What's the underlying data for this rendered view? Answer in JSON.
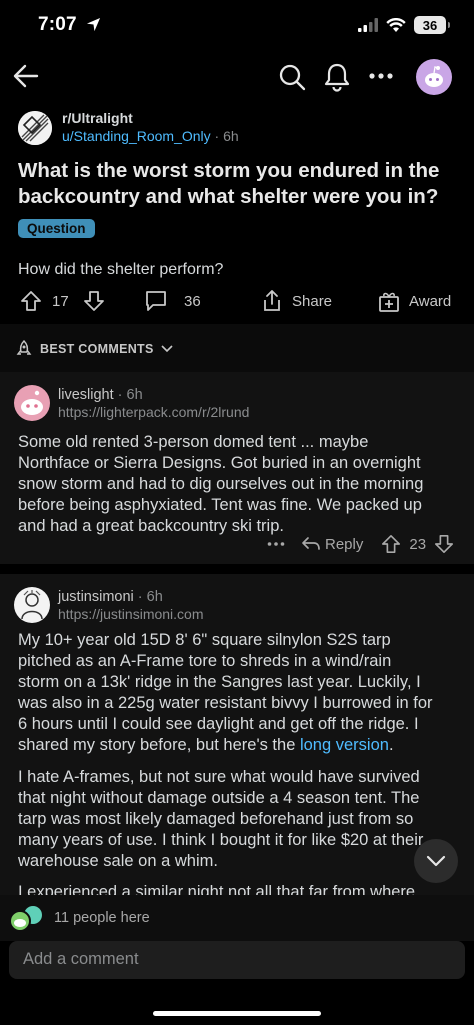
{
  "status_bar": {
    "time": "7:07",
    "battery": "36"
  },
  "header": {
    "back_icon": "arrow-left-icon",
    "search_icon": "search-icon",
    "bell_icon": "bell-icon",
    "more_icon": "more-horizontal-icon"
  },
  "post": {
    "subreddit": "r/Ultralight",
    "author": "u/Standing_Room_Only",
    "age": "6h",
    "title": "What is the worst storm you endured in the backcountry and what shelter were you in?",
    "flair": "Question",
    "body": "How did the shelter perform?",
    "votes": "17",
    "comments": "36",
    "share_label": "Share",
    "award_label": "Award"
  },
  "sort": {
    "label": "BEST COMMENTS"
  },
  "comments": [
    {
      "author": "liveslight",
      "age": "6h",
      "flair": "https://lighterpack.com/r/2lrund",
      "lines": [
        "Some old rented 3-person domed tent ... maybe",
        "Northface or Sierra Designs.  Got buried in an overnight",
        "snow storm and had to dig ourselves out in the morning",
        "before being asphyxiated.  Tent was fine.  We packed up",
        "and had a great backcountry ski trip."
      ],
      "reply_label": "Reply",
      "votes": "23"
    },
    {
      "author": "justinsimoni",
      "age": "6h",
      "flair": "https://justinsimoni.com",
      "p1_lines": [
        "My 10+ year old 15D 8' 6\" square silnylon S2S tarp",
        "pitched as an A-Frame  tore to shreds in a wind/rain",
        "storm on a 13k' ridge in the Sangres last year. Luckily, I",
        "was also in a  225g water resistant bivvy I burrowed in for",
        "6 hours until I could see daylight and get off the ridge. I"
      ],
      "p1_last_prefix": "shared my story before, but here's the ",
      "p1_link": "long version",
      "p1_last_suffix": ".",
      "p2_lines": [
        "I hate A-frames, but not sure what would have survived",
        "that night without damage outside a 4 season tent. The",
        "tarp was most likely damaged beforehand just from so",
        "many years of use. I think I bought it for like $20 at their",
        "warehouse sale on a whim."
      ],
      "p3_partial": "I experienced a similar night not all that far from where"
    }
  ],
  "presence": {
    "text": "11 people here"
  },
  "composer": {
    "placeholder": "Add a comment"
  }
}
